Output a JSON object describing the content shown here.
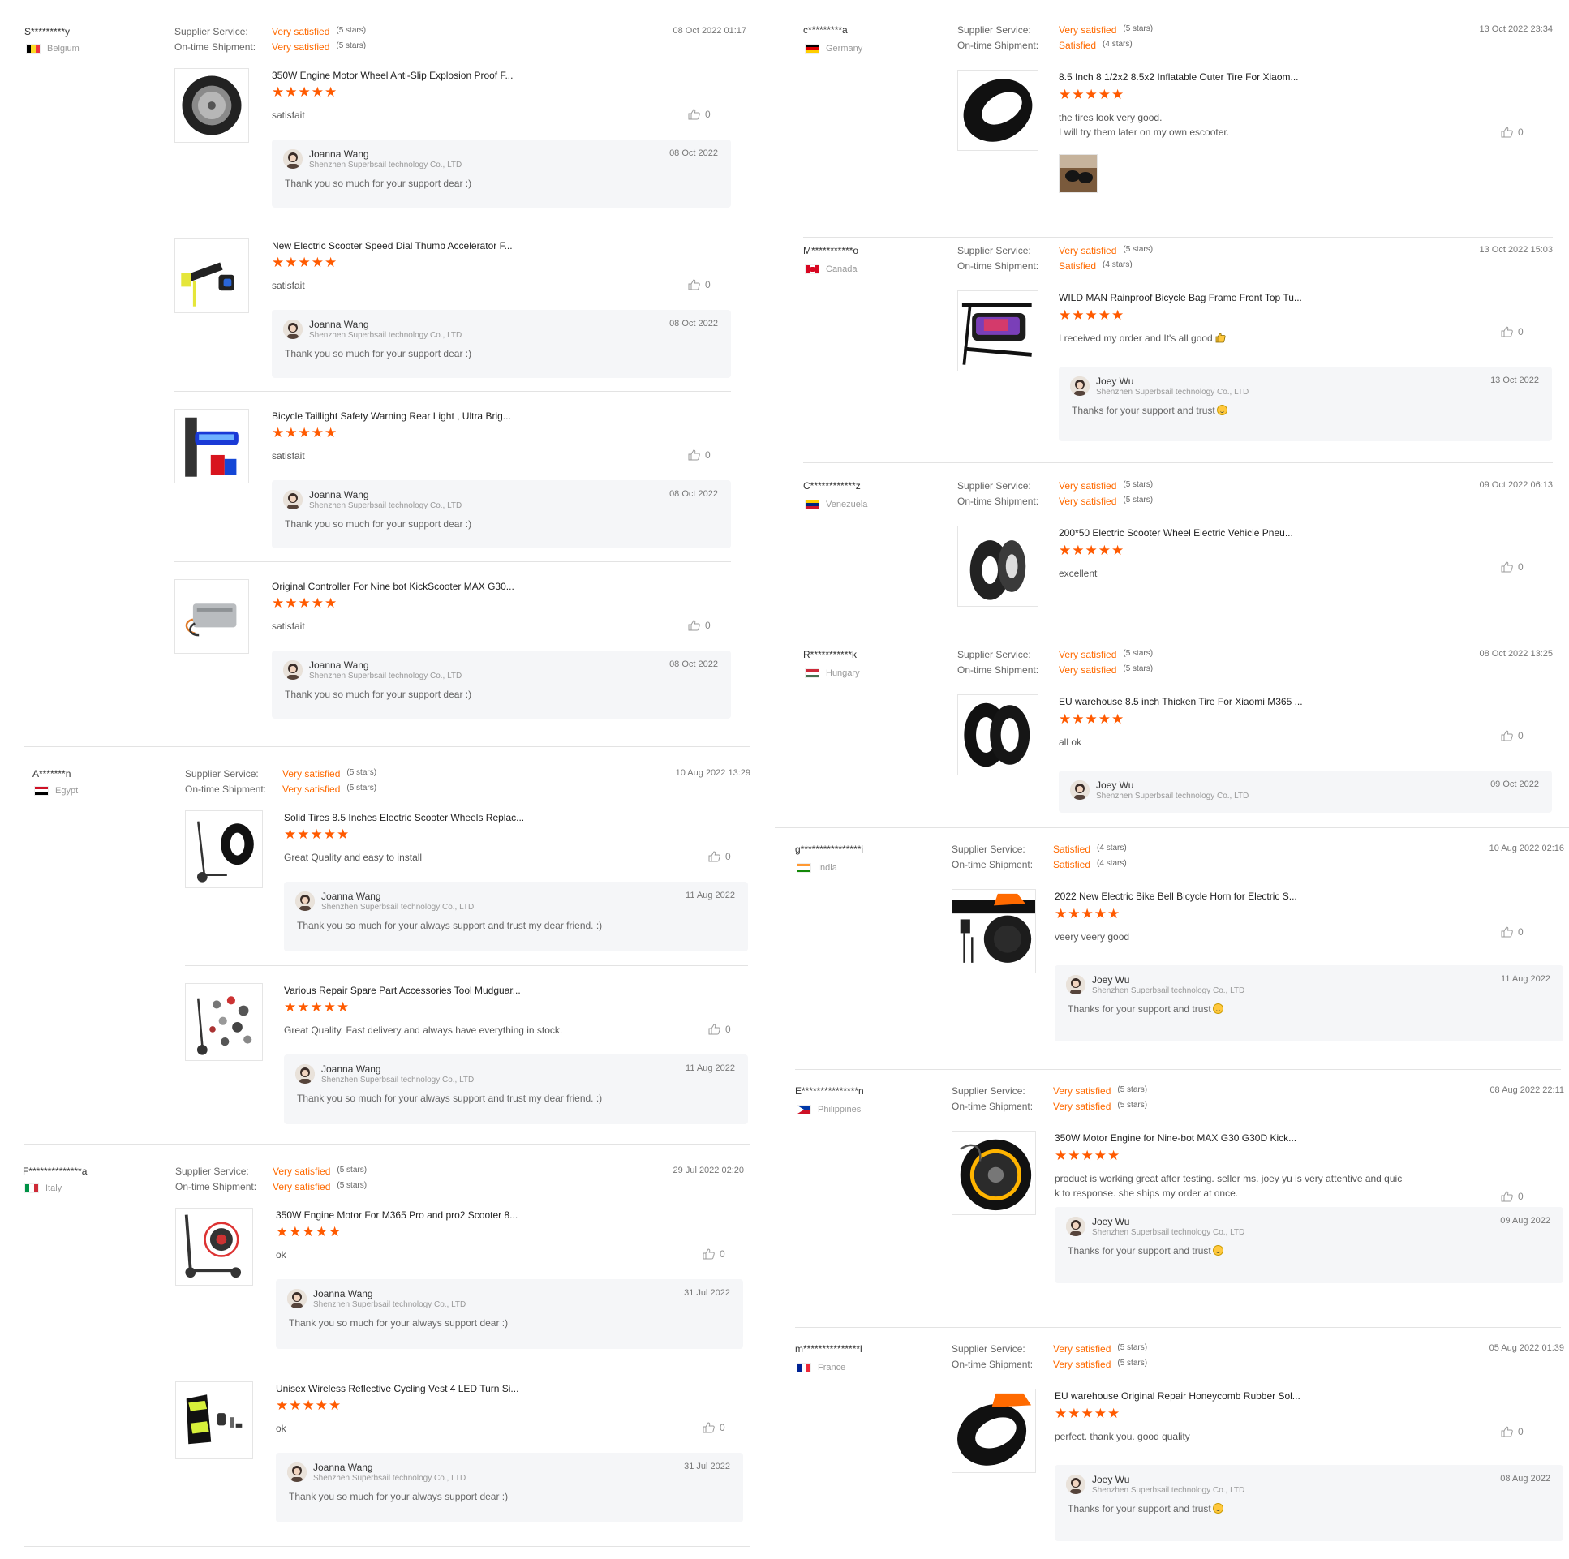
{
  "labels": {
    "supplier_service": "Supplier Service:",
    "ontime_shipment": "On-time Shipment:",
    "seller_company": "Shenzhen Superbsail technology Co., LTD",
    "joanna": "Joanna Wang",
    "joey": "Joey Wu"
  },
  "left": [
    {
      "buyer": "S*********y",
      "country": "Belgium",
      "date": "08 Oct 2022 01:17",
      "supplier_service": "Very satisfied",
      "supplier_stars": "(5 stars)",
      "ontime": "Very satisfied",
      "ontime_stars": "(5 stars)",
      "items": [
        {
          "title": "350W Engine Motor Wheel Anti-Slip Explosion Proof F...",
          "stars": 5,
          "text": "satisfait",
          "likes": "0",
          "icon": "motor-wheel-thumbnail",
          "reply": {
            "name": "Joanna Wang",
            "date": "08 Oct 2022",
            "message": "Thank you so much for your support dear :)"
          }
        },
        {
          "title": "New Electric Scooter Speed Dial Thumb Accelerator F...",
          "stars": 5,
          "text": "satisfait",
          "likes": "0",
          "icon": "thumb-accelerator-thumbnail",
          "reply": {
            "name": "Joanna Wang",
            "date": "08 Oct 2022",
            "message": "Thank you so much for your support dear :)"
          }
        },
        {
          "title": "Bicycle Taillight Safety Warning Rear Light , Ultra Brig...",
          "stars": 5,
          "text": "satisfait",
          "likes": "0",
          "icon": "taillight-thumbnail",
          "reply": {
            "name": "Joanna Wang",
            "date": "08 Oct 2022",
            "message": "Thank you so much for your support dear :)"
          }
        },
        {
          "title": "Original Controller For Nine bot KickScooter MAX G30...",
          "stars": 5,
          "text": "satisfait",
          "likes": "0",
          "icon": "controller-thumbnail",
          "reply": {
            "name": "Joanna Wang",
            "date": "08 Oct 2022",
            "message": "Thank you so much for your support dear :)"
          }
        }
      ]
    },
    {
      "buyer": "A*******n",
      "country": "Egypt",
      "date": "10 Aug 2022 13:29",
      "supplier_service": "Very satisfied",
      "supplier_stars": "(5 stars)",
      "ontime": "Very satisfied",
      "ontime_stars": "(5 stars)",
      "items": [
        {
          "title": "Solid Tires 8.5 Inches Electric Scooter Wheels Replac...",
          "stars": 5,
          "text": "Great Quality and easy to install",
          "likes": "0",
          "icon": "solid-tire-thumbnail",
          "reply": {
            "name": "Joanna Wang",
            "date": "11 Aug 2022",
            "message": "Thank you so much for your always support and trust my dear friend. :)"
          }
        },
        {
          "title": "Various Repair Spare Part Accessories Tool Mudguar...",
          "stars": 5,
          "text": "Great Quality, Fast delivery and always have everything in stock.",
          "likes": "0",
          "icon": "spare-parts-thumbnail",
          "reply": {
            "name": "Joanna Wang",
            "date": "11 Aug 2022",
            "message": "Thank you so much for your always support and trust my dear friend. :)"
          }
        }
      ]
    },
    {
      "buyer": "F**************a",
      "country": "Italy",
      "date": "29 Jul 2022 02:20",
      "supplier_service": "Very satisfied",
      "supplier_stars": "(5 stars)",
      "ontime": "Very satisfied",
      "ontime_stars": "(5 stars)",
      "items": [
        {
          "title": "350W Engine Motor For M365 Pro and pro2 Scooter 8...",
          "stars": 5,
          "text": "ok",
          "likes": "0",
          "icon": "scooter-motor-thumbnail",
          "reply": {
            "name": "Joanna Wang",
            "date": "31 Jul 2022",
            "message": "Thank you so much for your always support dear :)"
          }
        },
        {
          "title": "Unisex Wireless Reflective Cycling Vest 4 LED Turn Si...",
          "stars": 5,
          "text": "ok",
          "likes": "0",
          "icon": "cycling-vest-thumbnail",
          "reply": {
            "name": "Joanna Wang",
            "date": "31 Jul 2022",
            "message": "Thank you so much for your always support dear :)"
          }
        }
      ]
    }
  ],
  "right": [
    {
      "buyer": "c*********a",
      "country": "Germany",
      "date": "13 Oct 2022 23:34",
      "supplier_service": "Very satisfied",
      "supplier_stars": "(5 stars)",
      "ontime": "Satisfied",
      "ontime_stars": "(4 stars)",
      "item": {
        "title": "8.5 Inch 8 1/2x2 8.5x2 Inflatable Outer Tire For Xiaom...",
        "stars": 5,
        "text_lines": [
          "the tires  look very good.",
          "I will try them later on my own escooter."
        ],
        "likes": "0",
        "icon": "outer-tire-thumbnail",
        "photo": "buyer-photo-thumbnail"
      }
    },
    {
      "buyer": "M***********o",
      "country": "Canada",
      "date": "13 Oct 2022 15:03",
      "supplier_service": "Very satisfied",
      "supplier_stars": "(5 stars)",
      "ontime": "Satisfied",
      "ontime_stars": "(4 stars)",
      "item": {
        "title": "WILD MAN Rainproof Bicycle Bag Frame Front Top Tu...",
        "stars": 5,
        "text_lines": [
          "I received my order and It's all good"
        ],
        "likes": "0",
        "icon": "bicycle-bag-thumbnail",
        "reply": {
          "name": "Joey Wu",
          "date": "13 Oct 2022",
          "message": "Thanks for your support and trust"
        }
      }
    },
    {
      "buyer": "C************z",
      "country": "Venezuela",
      "date": "09 Oct 2022 06:13",
      "supplier_service": "Very satisfied",
      "supplier_stars": "(5 stars)",
      "ontime": "Very satisfied",
      "ontime_stars": "(5 stars)",
      "item": {
        "title": "200*50 Electric Scooter Wheel Electric Vehicle Pneu...",
        "stars": 5,
        "text_lines": [
          "excellent"
        ],
        "likes": "0",
        "icon": "scooter-wheel-thumbnail"
      }
    },
    {
      "buyer": "R***********k",
      "country": "Hungary",
      "date": "08 Oct 2022 13:25",
      "supplier_service": "Very satisfied",
      "supplier_stars": "(5 stars)",
      "ontime": "Very satisfied",
      "ontime_stars": "(5 stars)",
      "item": {
        "title": "EU warehouse 8.5 inch Thicken Tire For Xiaomi M365 ...",
        "stars": 5,
        "text_lines": [
          "all ok"
        ],
        "likes": "0",
        "icon": "thicken-tire-thumbnail",
        "reply": {
          "name": "Joey Wu",
          "date": "09 Oct 2022",
          "message": ""
        }
      }
    },
    {
      "buyer": "g****************i",
      "country": "India",
      "date": "10 Aug 2022 02:16",
      "supplier_service": "Satisfied",
      "supplier_stars": "(4 stars)",
      "ontime": "Satisfied",
      "ontime_stars": "(4 stars)",
      "item": {
        "title": "2022 New Electric Bike Bell Bicycle Horn for Electric S...",
        "stars": 5,
        "text_lines": [
          "veery veery good"
        ],
        "likes": "0",
        "icon": "bike-horn-thumbnail",
        "reply": {
          "name": "Joey Wu",
          "date": "11 Aug 2022",
          "message": "Thanks for your support and trust"
        }
      }
    },
    {
      "buyer": "E***************n",
      "country": "Philippines",
      "date": "08 Aug 2022 22:11",
      "supplier_service": "Very satisfied",
      "supplier_stars": "(5 stars)",
      "ontime": "Very satisfied",
      "ontime_stars": "(5 stars)",
      "item": {
        "title": "350W Motor Engine for Nine-bot MAX G30 G30D Kick...",
        "stars": 5,
        "text_lines": [
          "product is working great after testing. seller ms. joey yu is very attentive and quic",
          "k to response. she ships my order at once."
        ],
        "likes": "0",
        "icon": "g30-motor-thumbnail",
        "reply": {
          "name": "Joey Wu",
          "date": "09 Aug 2022",
          "message": "Thanks for your support and trust"
        }
      }
    },
    {
      "buyer": "m***************l",
      "country": "France",
      "date": "05 Aug 2022 01:39",
      "supplier_service": "Very satisfied",
      "supplier_stars": "(5 stars)",
      "ontime": "Very satisfied",
      "ontime_stars": "(5 stars)",
      "item": {
        "title": "EU warehouse Original Repair Honeycomb Rubber Sol...",
        "stars": 5,
        "text_lines": [
          "perfect. thank you. good quality"
        ],
        "likes": "0",
        "icon": "honeycomb-tire-thumbnail",
        "reply": {
          "name": "Joey Wu",
          "date": "08 Aug 2022",
          "message": "Thanks for your support and trust"
        }
      }
    }
  ],
  "star_glyph": "★★★★★",
  "colors": {
    "accent": "#ff6a00",
    "star": "#ff5a00"
  }
}
